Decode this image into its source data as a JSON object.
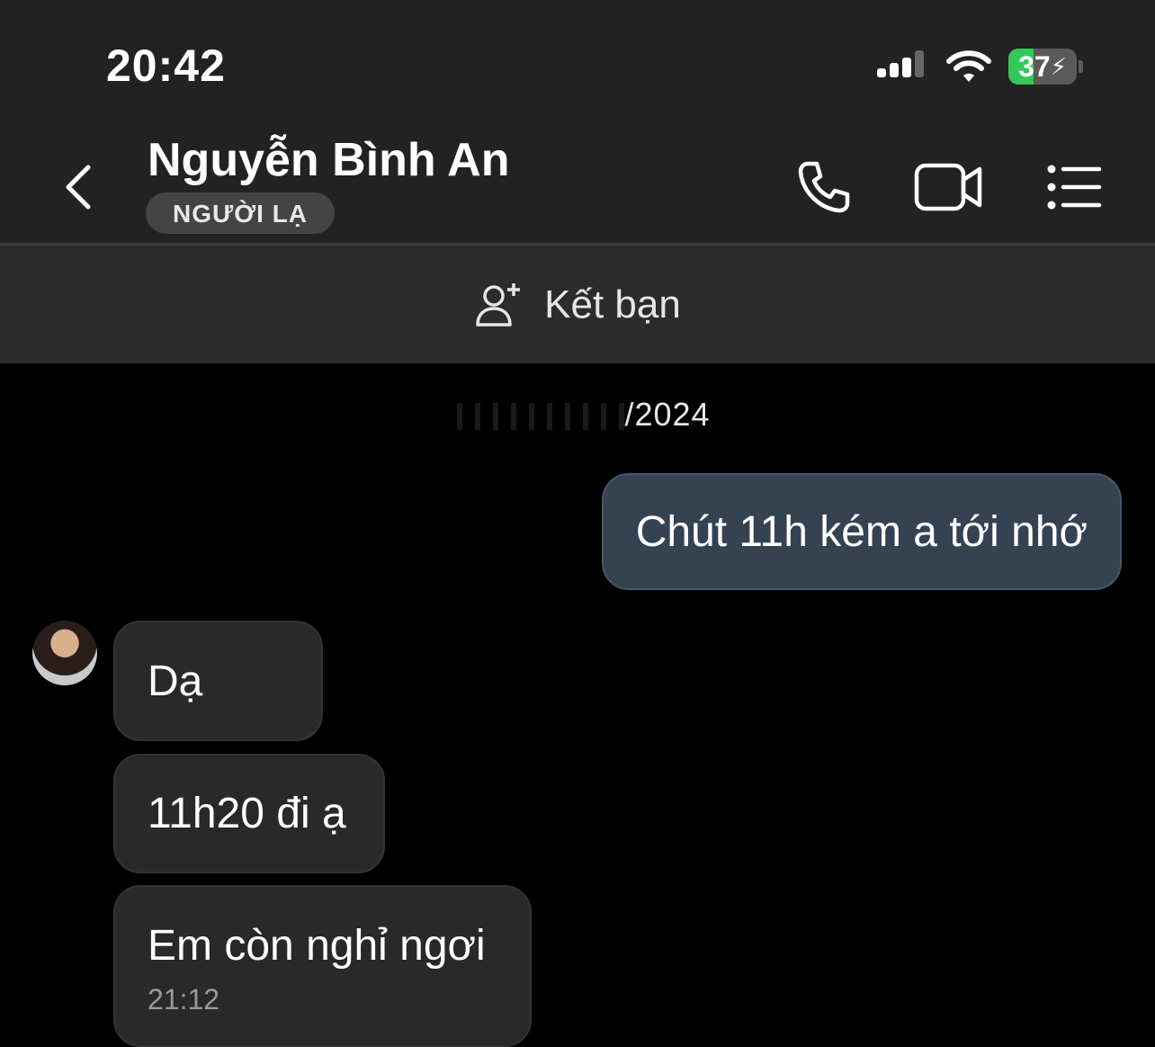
{
  "status_bar": {
    "time": "20:42",
    "battery_percent": "37",
    "battery_level": 0.37,
    "icons": [
      "signal-icon",
      "wifi-icon",
      "battery-icon"
    ]
  },
  "header": {
    "contact_name": "Nguyễn Bình An",
    "badge": "NGƯỜI LẠ",
    "icons": [
      "back-icon",
      "phone-icon",
      "video-call-icon",
      "menu-icon"
    ]
  },
  "add_friend": {
    "label": "Kết bạn",
    "icon": "add-person-icon"
  },
  "conversation": {
    "date_separator": "/2024",
    "messages": [
      {
        "direction": "out",
        "text": "Chút 11h kém a tới nhớ"
      },
      {
        "direction": "in",
        "text": "Dạ"
      },
      {
        "direction": "in",
        "text": "11h20 đi ạ"
      },
      {
        "direction": "in",
        "text": "Em còn nghỉ ngơi",
        "time": "21:12"
      }
    ]
  },
  "colors": {
    "header_bg": "#222222",
    "chat_bg": "#000000",
    "outgoing_bubble": "#354252",
    "incoming_bubble": "#292929",
    "battery_green": "#34c759"
  }
}
